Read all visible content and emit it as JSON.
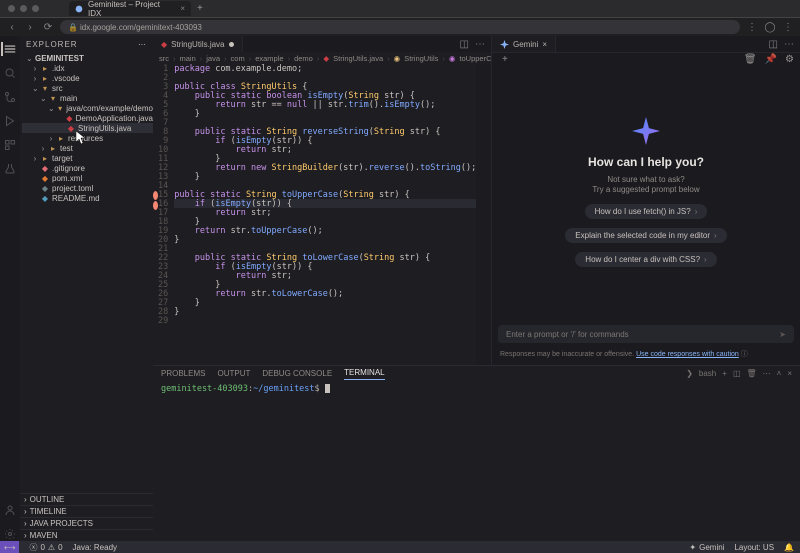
{
  "browser": {
    "tab_title": "Geminitest – Project IDX",
    "url": "idx.google.com/geminitext-403093"
  },
  "sidebar": {
    "title": "EXPLORER",
    "project": "GEMINITEST",
    "tree": {
      "idx": ".idx",
      "vscode": ".vscode",
      "src": "src",
      "main": "main",
      "pkg": "java/com/example/demo",
      "file1": "DemoApplication.java",
      "file2": "StringUtils.java",
      "resources": "resources",
      "test": "test",
      "target": "target",
      "gitignore": ".gitignore",
      "pom": "pom.xml",
      "toml": "project.toml",
      "readme": "README.md"
    },
    "sections": {
      "outline": "OUTLINE",
      "timeline": "TIMELINE",
      "javaprojects": "JAVA PROJECTS",
      "maven": "MAVEN"
    }
  },
  "editor": {
    "tab": "StringUtils.java",
    "breadcrumb": [
      "src",
      "main",
      "java",
      "com",
      "example",
      "demo",
      "StringUtils.java",
      "StringUtils",
      "toUpperCase(String)"
    ],
    "lines": [
      "package com.example.demo;",
      "",
      "public class StringUtils {",
      "    public static boolean isEmpty(String str) {",
      "        return str == null || str.trim().isEmpty();",
      "    }",
      "",
      "    public static String reverseString(String str) {",
      "        if (isEmpty(str)) {",
      "            return str;",
      "        }",
      "        return new StringBuilder(str).reverse().toString();",
      "    }",
      "",
      "public static String toUpperCase(String str) {",
      "    if (isEmpty(str)) {",
      "        return str;",
      "    }",
      "    return str.toUpperCase();",
      "}",
      "",
      "    public static String toLowerCase(String str) {",
      "        if (isEmpty(str)) {",
      "            return str;",
      "        }",
      "        return str.toLowerCase();",
      "    }",
      "}",
      ""
    ]
  },
  "gemini": {
    "tab": "Gemini",
    "how": "How can I help you?",
    "sub1": "Not sure what to ask?",
    "sub2": "Try a suggested prompt below",
    "pill1": "How do I use fetch() in JS?",
    "pill2": "Explain the selected code in my editor",
    "pill3": "How do I center a div with CSS?",
    "placeholder": "Enter a prompt or '/' for commands",
    "foot_pre": "Responses may be inaccurate or offensive. ",
    "foot_link": "Use code responses with caution"
  },
  "panel": {
    "tabs": {
      "problems": "PROBLEMS",
      "output": "OUTPUT",
      "debug": "DEBUG CONSOLE",
      "terminal": "TERMINAL"
    },
    "shell_label": "bash",
    "prompt_user": "geminitest-403093",
    "prompt_path": "~/geminitest"
  },
  "status": {
    "errors": "0",
    "warnings": "0",
    "java": "Java: Ready",
    "gemini": "Gemini",
    "layout": "Layout: US",
    "bell": ""
  }
}
